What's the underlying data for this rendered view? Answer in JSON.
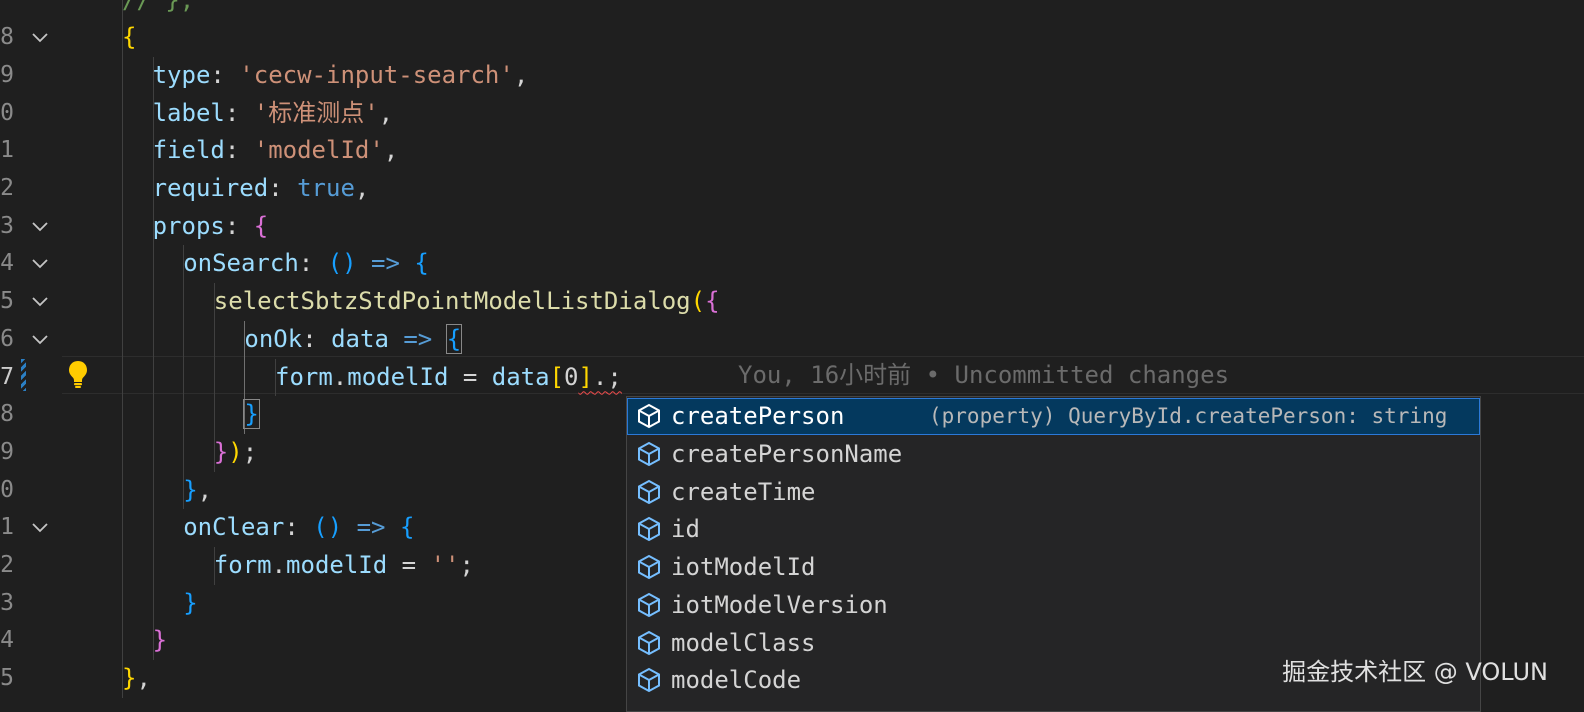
{
  "editor": {
    "gutter": {
      "line_numbers": [
        "8",
        "9",
        "0",
        "1",
        "2",
        "3",
        "4",
        "5",
        "6",
        "7",
        "8",
        "9",
        "0",
        "1",
        "2",
        "3",
        "4",
        "5"
      ],
      "active_line_number": "7"
    },
    "lines": [
      {
        "tokens": [
          [
            "c",
            "// },"
          ]
        ]
      },
      {
        "tokens": [
          [
            "br1",
            "{"
          ]
        ]
      },
      {
        "tokens": [
          [
            "k",
            "type"
          ],
          [
            "p",
            ": "
          ],
          [
            "s",
            "'cecw-input-search'"
          ],
          [
            "p",
            ","
          ]
        ]
      },
      {
        "tokens": [
          [
            "k",
            "label"
          ],
          [
            "p",
            ": "
          ],
          [
            "s",
            "'标准测点'"
          ],
          [
            "p",
            ","
          ]
        ]
      },
      {
        "tokens": [
          [
            "k",
            "field"
          ],
          [
            "p",
            ": "
          ],
          [
            "s",
            "'modelId'"
          ],
          [
            "p",
            ","
          ]
        ]
      },
      {
        "tokens": [
          [
            "k",
            "required"
          ],
          [
            "p",
            ": "
          ],
          [
            "b",
            "true"
          ],
          [
            "p",
            ","
          ]
        ]
      },
      {
        "tokens": [
          [
            "k",
            "props"
          ],
          [
            "p",
            ": "
          ],
          [
            "br2",
            "{"
          ]
        ]
      },
      {
        "tokens": [
          [
            "k",
            "onSearch"
          ],
          [
            "p",
            ": "
          ],
          [
            "br3",
            "()"
          ],
          [
            "p",
            " "
          ],
          [
            "b",
            "=>"
          ],
          [
            "p",
            " "
          ],
          [
            "br3",
            "{"
          ]
        ]
      },
      {
        "tokens": [
          [
            "f",
            "selectSbtzStdPointModelListDialog"
          ],
          [
            "br1",
            "("
          ],
          [
            "br2",
            "{"
          ]
        ]
      },
      {
        "tokens": [
          [
            "k",
            "onOk"
          ],
          [
            "p",
            ": "
          ],
          [
            "v",
            "data"
          ],
          [
            "p",
            " "
          ],
          [
            "b",
            "=>"
          ],
          [
            "p",
            " "
          ],
          [
            "br3",
            "{"
          ]
        ]
      },
      {
        "tokens": [
          [
            "v",
            "form"
          ],
          [
            "p",
            "."
          ],
          [
            "v",
            "modelId"
          ],
          [
            "p",
            " = "
          ],
          [
            "v",
            "data"
          ],
          [
            "br1",
            "["
          ],
          [
            "num",
            "0"
          ],
          [
            "br1",
            "]"
          ],
          [
            "p",
            "."
          ],
          [
            "p",
            ";"
          ]
        ]
      },
      {
        "tokens": [
          [
            "br3",
            "}"
          ]
        ]
      },
      {
        "tokens": [
          [
            "br2",
            "}"
          ],
          [
            "br1",
            ")"
          ],
          [
            "p",
            ";"
          ]
        ]
      },
      {
        "tokens": [
          [
            "br3",
            "}"
          ],
          [
            "p",
            ","
          ]
        ]
      },
      {
        "tokens": [
          [
            "k",
            "onClear"
          ],
          [
            "p",
            ": "
          ],
          [
            "br3",
            "()"
          ],
          [
            "p",
            " "
          ],
          [
            "b",
            "=>"
          ],
          [
            "p",
            " "
          ],
          [
            "br3",
            "{"
          ]
        ]
      },
      {
        "tokens": [
          [
            "v",
            "form"
          ],
          [
            "p",
            "."
          ],
          [
            "v",
            "modelId"
          ],
          [
            "p",
            " = "
          ],
          [
            "s",
            "''"
          ],
          [
            "p",
            ";"
          ]
        ]
      },
      {
        "tokens": [
          [
            "br3",
            "}"
          ]
        ]
      },
      {
        "tokens": [
          [
            "br2",
            "}"
          ]
        ]
      },
      {
        "tokens": [
          [
            "br1",
            "}"
          ],
          [
            "p",
            ","
          ]
        ]
      }
    ],
    "inline_blame": "You, 16小时前 • Uncommitted changes"
  },
  "suggest_widget": {
    "items": [
      {
        "label": "createPerson",
        "detail": "(property) QueryById.createPerson: string",
        "icon": "property-cube-icon",
        "selected": true
      },
      {
        "label": "createPersonName",
        "detail": "",
        "icon": "property-cube-icon",
        "selected": false
      },
      {
        "label": "createTime",
        "detail": "",
        "icon": "property-cube-icon",
        "selected": false
      },
      {
        "label": "id",
        "detail": "",
        "icon": "property-cube-icon",
        "selected": false
      },
      {
        "label": "iotModelId",
        "detail": "",
        "icon": "property-cube-icon",
        "selected": false
      },
      {
        "label": "iotModelVersion",
        "detail": "",
        "icon": "property-cube-icon",
        "selected": false
      },
      {
        "label": "modelClass",
        "detail": "",
        "icon": "property-cube-icon",
        "selected": false
      },
      {
        "label": "modelCode",
        "detail": "",
        "icon": "property-cube-icon",
        "selected": false
      }
    ]
  },
  "watermark": "掘金技术社区 @ VOLUN",
  "colors": {
    "background": "#1f1f1f",
    "selection": "#04395e",
    "string": "#ce9178",
    "property": "#9cdcfe",
    "keyword": "#569cd6",
    "function": "#dcdcaa",
    "bracket1": "#ffd700",
    "bracket2": "#da70d6",
    "bracket3": "#179fff"
  }
}
